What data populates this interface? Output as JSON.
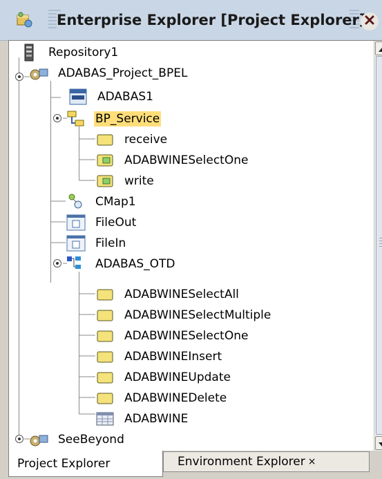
{
  "window": {
    "title": "Enterprise Explorer [Project Explorer]"
  },
  "tree": {
    "items": [
      {
        "label": "Repository1",
        "icon": "repository-icon",
        "selected": false
      },
      {
        "label": "ADABAS_Project_BPEL",
        "icon": "project-icon",
        "selected": false
      },
      {
        "label": "ADABAS1",
        "icon": "adabas-connector-icon",
        "selected": false
      },
      {
        "label": "BP_Service",
        "icon": "business-process-icon",
        "selected": true
      },
      {
        "label": "receive",
        "icon": "folder-icon",
        "selected": false
      },
      {
        "label": "ADABWINESelectOne",
        "icon": "folder-operation-icon",
        "selected": false
      },
      {
        "label": "write",
        "icon": "folder-operation-icon",
        "selected": false
      },
      {
        "label": "CMap1",
        "icon": "connectivity-map-icon",
        "selected": false
      },
      {
        "label": "FileOut",
        "icon": "file-external-icon",
        "selected": false
      },
      {
        "label": "FileIn",
        "icon": "file-external-icon",
        "selected": false
      },
      {
        "label": "ADABAS_OTD",
        "icon": "otd-icon",
        "selected": false
      },
      {
        "label": "ADABWINESelectAll",
        "icon": "folder-icon",
        "selected": false
      },
      {
        "label": "ADABWINESelectMultiple",
        "icon": "folder-icon",
        "selected": false
      },
      {
        "label": "ADABWINESelectOne",
        "icon": "folder-icon",
        "selected": false
      },
      {
        "label": "ADABWINEInsert",
        "icon": "folder-icon",
        "selected": false
      },
      {
        "label": "ADABWINEUpdate",
        "icon": "folder-icon",
        "selected": false
      },
      {
        "label": "ADABWINEDelete",
        "icon": "folder-icon",
        "selected": false
      },
      {
        "label": "ADABWINE",
        "icon": "table-icon",
        "selected": false
      },
      {
        "label": "SeeBeyond",
        "icon": "project-icon",
        "selected": false
      }
    ]
  },
  "tabs": [
    {
      "label": "Project Explorer",
      "active": true
    },
    {
      "label": "Environment Explorer",
      "close": "×",
      "active": false
    }
  ],
  "colors": {
    "selection": "#ffde7a",
    "titlebar": "#c9d6e5"
  }
}
